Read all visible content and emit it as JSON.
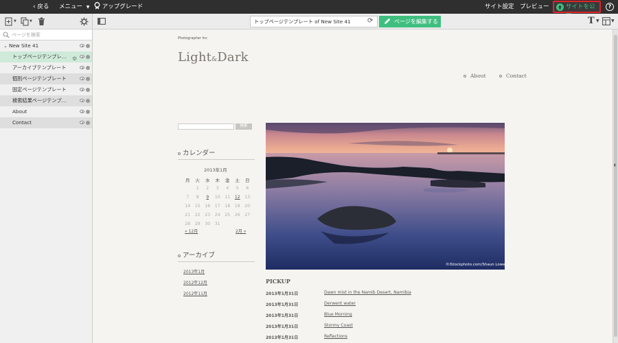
{
  "topbar": {
    "back_label": "戻る",
    "menu_label": "メニュー",
    "upgrade_label": "アップグレード",
    "site_settings_label": "サイト設定",
    "preview_label": "プレビュー",
    "publish_label": "サイトを公開",
    "help_label": "?"
  },
  "sidebar": {
    "search_placeholder": "ページを検索",
    "site_name": "New Site 41",
    "items": [
      {
        "label": "トップページテンプレ…"
      },
      {
        "label": "アーカイブテンプレート"
      },
      {
        "label": "個別ページテンプレート"
      },
      {
        "label": "固定ページテンプレート"
      },
      {
        "label": "検索結果ページテンプ…"
      },
      {
        "label": "About"
      },
      {
        "label": "Contact"
      }
    ]
  },
  "editbar": {
    "page_title": "トップページテンプレート of New Site 41",
    "edit_button_label": "ページを編集する",
    "text_tool_label": "T"
  },
  "preview": {
    "tagline": "Photographer Inc",
    "logo_main": "Light",
    "logo_amp": "&",
    "logo_end": "Dark",
    "nav": [
      "About",
      "Contact"
    ],
    "search_button": "検索",
    "calendar_title": "カレンダー",
    "calendar_caption": "2013年1月",
    "weekdays": [
      "月",
      "火",
      "水",
      "木",
      "金",
      "土",
      "日"
    ],
    "calendar_rows": [
      [
        "",
        "1",
        "2",
        "3",
        "4",
        "5",
        "6"
      ],
      [
        "7",
        "8",
        "9",
        "10",
        "11",
        "12",
        "13"
      ],
      [
        "14",
        "15",
        "16",
        "17",
        "18",
        "19",
        "20"
      ],
      [
        "21",
        "22",
        "23",
        "24",
        "25",
        "26",
        "27"
      ],
      [
        "28",
        "29",
        "30",
        "31",
        "",
        "",
        ""
      ]
    ],
    "calendar_linked_days": [
      "9",
      "12"
    ],
    "prev_month": "« 12月",
    "next_month": "2月 »",
    "archive_title": "アーカイブ",
    "archives": [
      "2013年1月",
      "2012年12月",
      "2012年11月"
    ],
    "photo_credit": "©iStockphoto.com/Shaun Lowe",
    "pickup_title": "PICKUP",
    "pickup": [
      {
        "date": "2013年1月31日",
        "title": "Dawn mist in the Namib Desert, Namibia"
      },
      {
        "date": "2013年1月31日",
        "title": "Derwent water"
      },
      {
        "date": "2013年1月31日",
        "title": "Blue Morning"
      },
      {
        "date": "2013年1月31日",
        "title": "Stormy Coast"
      },
      {
        "date": "2013年1月31日",
        "title": "Reflections"
      }
    ]
  },
  "colors": {
    "topbar_bg": "#2f2f2f",
    "accent_green": "#3fbf7f",
    "publish_highlight": "#e2232a",
    "active_row": "#cfead9"
  },
  "icons": [
    "chevron-left-icon",
    "upgrade-icon",
    "add-page-icon",
    "duplicate-icon",
    "trash-icon",
    "gear-icon",
    "search-icon",
    "sidebar-toggle-icon",
    "reload-icon",
    "pencil-icon",
    "text-icon",
    "layout-icon",
    "help-icon",
    "eye-icon"
  ]
}
